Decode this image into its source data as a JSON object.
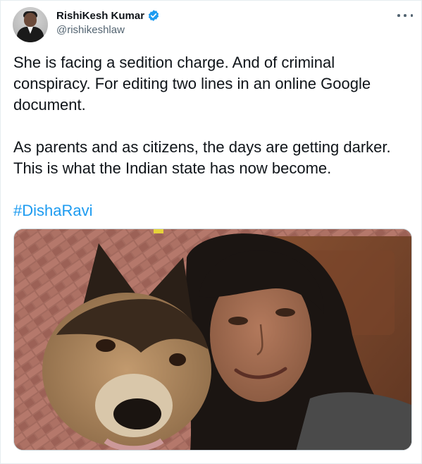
{
  "tweet": {
    "author": {
      "display_name": "RishiKesh Kumar",
      "handle": "@rishikeshlaw",
      "verified": true,
      "avatar_icon": "profile-photo"
    },
    "more_icon": "more-horizontal-icon",
    "text": {
      "line1": "She is facing a sedition charge. And of criminal",
      "line2": "conspiracy. For editing two lines in an online Google",
      "line3": "document.",
      "line4": "As parents and as citizens, the days are getting darker.",
      "line5": "This is what the Indian state has now become.",
      "hashtag": "#DishaRavi"
    },
    "media": {
      "kind": "photo",
      "subject": "selfie of a woman with a German Shepherd dog"
    },
    "colors": {
      "link": "#1d9bf0",
      "verified_badge": "#1d9bf0",
      "secondary_text": "#536471"
    }
  }
}
